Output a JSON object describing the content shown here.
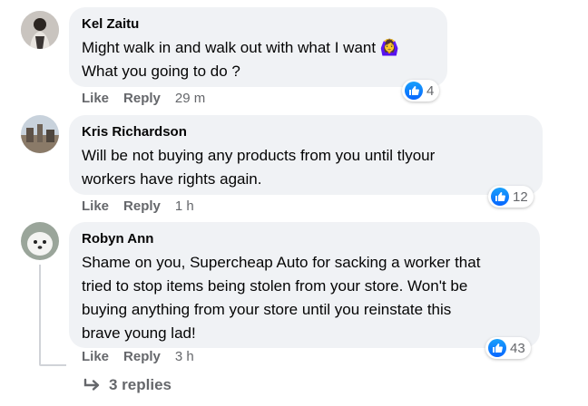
{
  "comments": [
    {
      "author": "Kel Zaitu",
      "lines": [
        "Might walk in and walk out with what I want 🙆‍♀️",
        "What you going to do ?"
      ],
      "actions": {
        "like": "Like",
        "reply": "Reply",
        "time": "29 m"
      },
      "reaction_count": "4"
    },
    {
      "author": "Kris Richardson",
      "lines": [
        "Will be not buying any products from you until tlyour",
        "workers have rights again."
      ],
      "actions": {
        "like": "Like",
        "reply": "Reply",
        "time": "1 h"
      },
      "reaction_count": "12"
    },
    {
      "author": "Robyn Ann",
      "lines": [
        "Shame on you, Supercheap Auto for sacking a worker that",
        "tried to stop items being stolen from your store. Won't be",
        "buying anything from your store until you reinstate this",
        "brave young lad!"
      ],
      "actions": {
        "like": "Like",
        "reply": "Reply",
        "time": "3 h"
      },
      "reaction_count": "43"
    }
  ],
  "replies_label": "3 replies",
  "colors": {
    "bubble": "#f0f2f5",
    "secondary_text": "#65676b",
    "like_blue": "#0866ff",
    "thread_line": "#d0d3d8"
  }
}
